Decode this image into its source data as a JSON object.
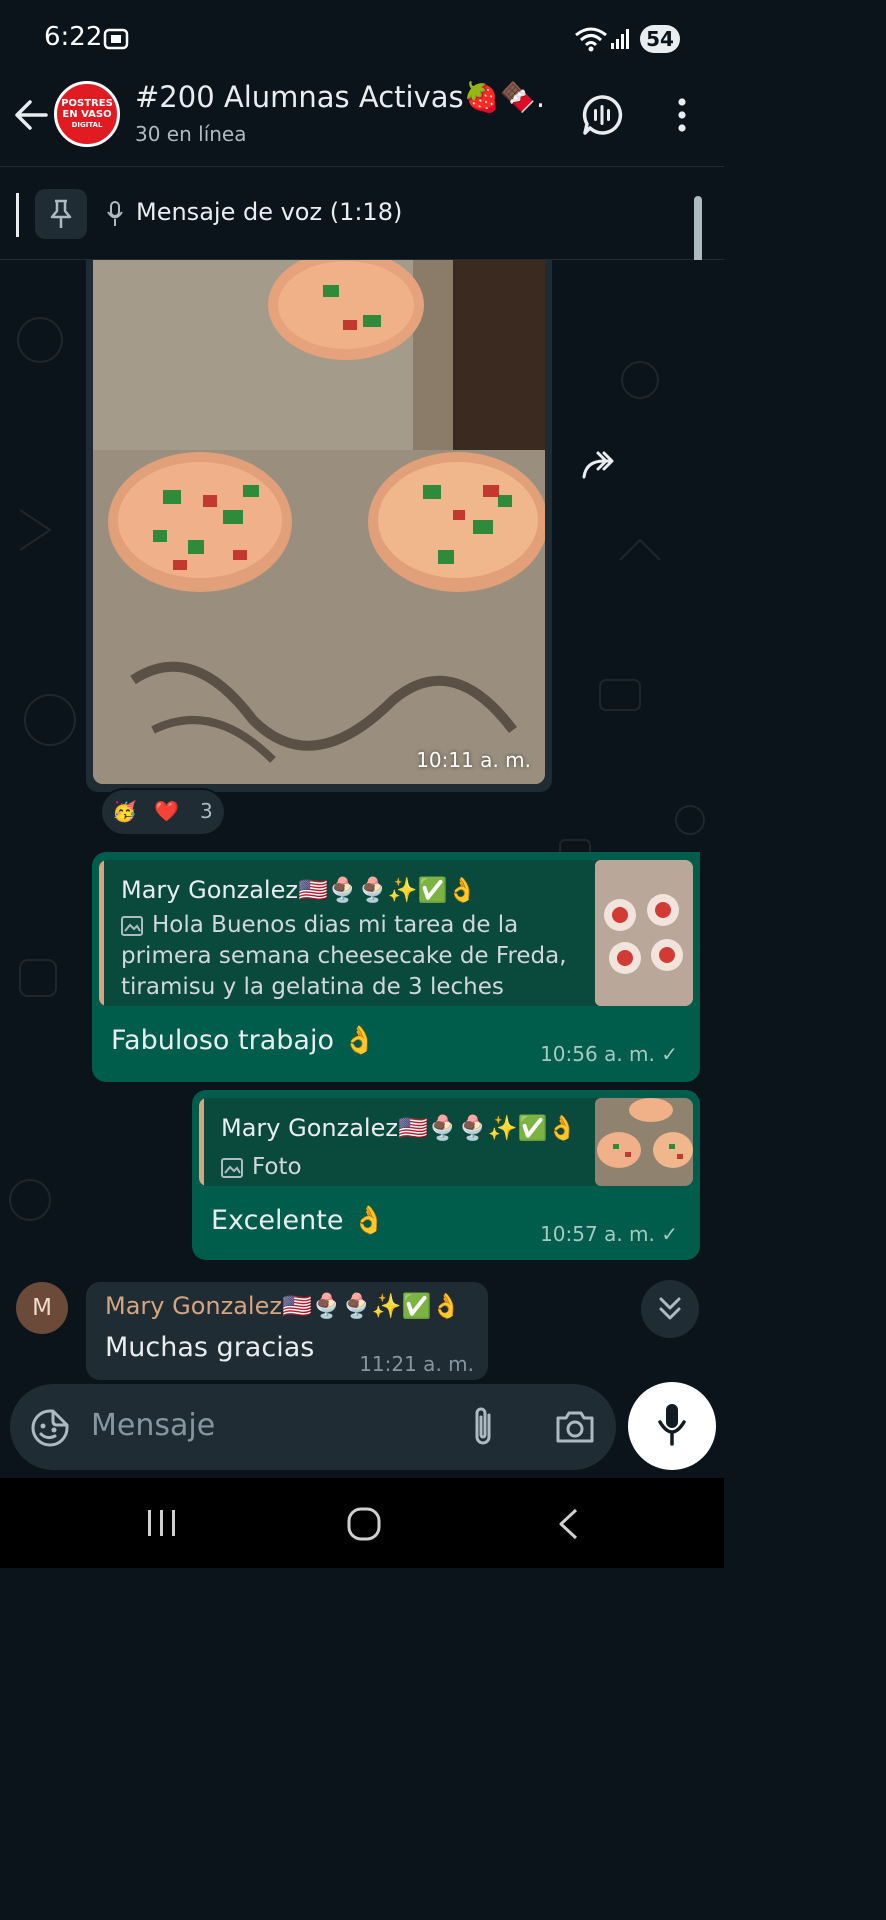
{
  "status_bar": {
    "time": "6:22",
    "battery": "54"
  },
  "header": {
    "title": "#200 Alumnas Activas🍓🍫...",
    "subtitle": "30 en línea",
    "avatar_lines": [
      "POSTRES",
      "EN VASO",
      "DIGITAL"
    ]
  },
  "pinned": {
    "text": "Mensaje de voz (1:18)"
  },
  "photo_message": {
    "time": "10:11 a. m.",
    "reactions": {
      "emojis": [
        "🥳",
        "❤️"
      ],
      "count": "3"
    }
  },
  "messages": [
    {
      "quote_name": "Mary Gonzalez🇺🇸🍨🍨✨✅👌",
      "quote_lines": [
        "Hola Buenos dias mi tarea de la",
        "primera semana cheesecake de Freda,",
        "tiramisu y la gelatina de 3 leches"
      ],
      "text": "Fabuloso trabajo 👌",
      "time": "10:56 a. m. ✓"
    },
    {
      "quote_name": "Mary Gonzalez🇺🇸🍨🍨✨✅👌",
      "quote_lines": [
        "Foto"
      ],
      "text": "Excelente 👌",
      "time": "10:57 a. m. ✓"
    }
  ],
  "incoming": {
    "avatar_letter": "M",
    "sender": "Mary Gonzalez🇺🇸🍨🍨✨✅👌",
    "text": "Muchas gracias",
    "time": "11:21 a. m."
  },
  "input": {
    "placeholder": "Mensaje"
  },
  "colors": {
    "bubble_out": "#005c4b",
    "bubble_in": "#1f2c33",
    "background": "#0b141a",
    "sender_name": "#d6a47f"
  }
}
